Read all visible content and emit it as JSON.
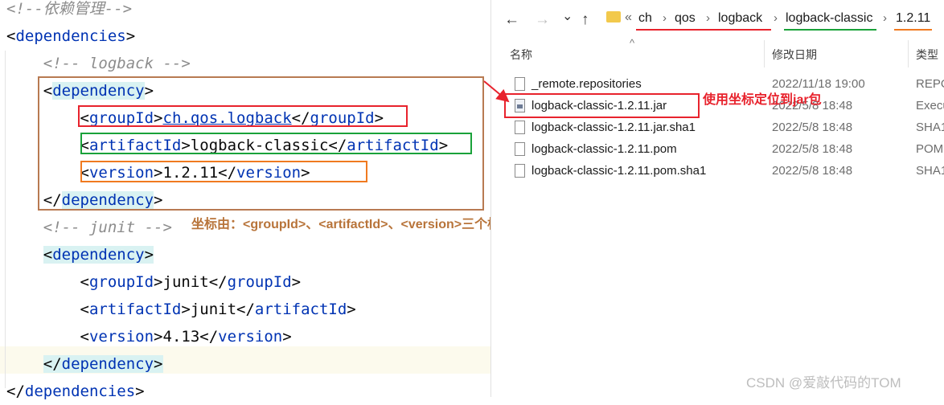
{
  "editor": {
    "lines": [
      {
        "segments": [
          {
            "text": "<!--依赖管理-->",
            "cls": "c"
          }
        ]
      },
      {
        "segments": [
          {
            "text": "<",
            "cls": "b"
          },
          {
            "text": "dependencies",
            "cls": "t"
          },
          {
            "text": ">",
            "cls": "b"
          }
        ]
      },
      {
        "segments": [
          {
            "text": "    "
          },
          {
            "text": "<!-- logback -->",
            "cls": "c"
          }
        ]
      },
      {
        "segments": [
          {
            "text": "    "
          },
          {
            "text": "<",
            "cls": "b"
          },
          {
            "text": "dependency",
            "cls": "t hl"
          },
          {
            "text": ">",
            "cls": "b"
          }
        ]
      },
      {
        "segments": [
          {
            "text": "        "
          },
          {
            "text": "<",
            "cls": "b"
          },
          {
            "text": "groupId",
            "cls": "t"
          },
          {
            "text": ">",
            "cls": "b"
          },
          {
            "text": "ch.qos.logback",
            "cls": "t u"
          },
          {
            "text": "</",
            "cls": "b"
          },
          {
            "text": "groupId",
            "cls": "t"
          },
          {
            "text": ">",
            "cls": "b"
          }
        ]
      },
      {
        "segments": [
          {
            "text": "        "
          },
          {
            "text": "<",
            "cls": "b"
          },
          {
            "text": "artifactId",
            "cls": "t"
          },
          {
            "text": ">",
            "cls": "b"
          },
          {
            "text": "logback-classic",
            "cls": "b"
          },
          {
            "text": "</",
            "cls": "b"
          },
          {
            "text": "artifactId",
            "cls": "t"
          },
          {
            "text": ">",
            "cls": "b"
          }
        ]
      },
      {
        "segments": [
          {
            "text": "        "
          },
          {
            "text": "<",
            "cls": "b"
          },
          {
            "text": "version",
            "cls": "t"
          },
          {
            "text": ">",
            "cls": "b"
          },
          {
            "text": "1.2.11",
            "cls": "b"
          },
          {
            "text": "</",
            "cls": "b"
          },
          {
            "text": "version",
            "cls": "t"
          },
          {
            "text": ">",
            "cls": "b"
          }
        ]
      },
      {
        "segments": [
          {
            "text": "    "
          },
          {
            "text": "</",
            "cls": "b"
          },
          {
            "text": "dependency",
            "cls": "t hl"
          },
          {
            "text": ">",
            "cls": "b"
          }
        ]
      },
      {
        "segments": [
          {
            "text": "    "
          },
          {
            "text": "<!-- junit -->",
            "cls": "c"
          }
        ]
      },
      {
        "segments": [
          {
            "text": "    "
          },
          {
            "text": "<",
            "cls": "b hl"
          },
          {
            "text": "dependency",
            "cls": "t hl"
          },
          {
            "text": ">",
            "cls": "b hl"
          }
        ]
      },
      {
        "segments": [
          {
            "text": "        "
          },
          {
            "text": "<",
            "cls": "b"
          },
          {
            "text": "groupId",
            "cls": "t"
          },
          {
            "text": ">",
            "cls": "b"
          },
          {
            "text": "junit",
            "cls": "b"
          },
          {
            "text": "</",
            "cls": "b"
          },
          {
            "text": "groupId",
            "cls": "t"
          },
          {
            "text": ">",
            "cls": "b"
          }
        ]
      },
      {
        "segments": [
          {
            "text": "        "
          },
          {
            "text": "<",
            "cls": "b"
          },
          {
            "text": "artifactId",
            "cls": "t"
          },
          {
            "text": ">",
            "cls": "b"
          },
          {
            "text": "junit",
            "cls": "b"
          },
          {
            "text": "</",
            "cls": "b"
          },
          {
            "text": "artifactId",
            "cls": "t"
          },
          {
            "text": ">",
            "cls": "b"
          }
        ]
      },
      {
        "segments": [
          {
            "text": "        "
          },
          {
            "text": "<",
            "cls": "b"
          },
          {
            "text": "version",
            "cls": "t"
          },
          {
            "text": ">",
            "cls": "b"
          },
          {
            "text": "4.13",
            "cls": "b"
          },
          {
            "text": "</",
            "cls": "b"
          },
          {
            "text": "version",
            "cls": "t"
          },
          {
            "text": ">",
            "cls": "b"
          }
        ]
      },
      {
        "segments": [
          {
            "text": "    "
          },
          {
            "text": "</",
            "cls": "b hl"
          },
          {
            "text": "dependency",
            "cls": "t hl"
          },
          {
            "text": ">",
            "cls": "b hl"
          }
        ]
      },
      {
        "segments": [
          {
            "text": "</",
            "cls": "b"
          },
          {
            "text": "dependencies",
            "cls": "t"
          },
          {
            "text": ">",
            "cls": "b"
          }
        ]
      }
    ]
  },
  "annotations": {
    "coordinate_note": "坐标由：<groupId>、<artifactId>、<version>三个标签组成",
    "jar_note": "使用坐标定位到jar包"
  },
  "explorer": {
    "nav": {
      "back": "←",
      "forward": "→",
      "dropdown": "⌄",
      "up": "↑",
      "overflow": "«"
    },
    "breadcrumb": [
      "ch",
      "qos",
      "logback",
      "logback-classic",
      "1.2.11"
    ],
    "columns": {
      "name": "名称",
      "modified": "修改日期",
      "type": "类型",
      "sort_arrow": "^"
    },
    "files": [
      {
        "name": "_remote.repositories",
        "modified": "2022/11/18 19:00",
        "type": "REPO",
        "icon": "file-icon"
      },
      {
        "name": "logback-classic-1.2.11.jar",
        "modified": "2022/5/8 18:48",
        "type": "Execu",
        "icon": "jar-file-icon"
      },
      {
        "name": "logback-classic-1.2.11.jar.sha1",
        "modified": "2022/5/8 18:48",
        "type": "SHA1",
        "icon": "file-icon"
      },
      {
        "name": "logback-classic-1.2.11.pom",
        "modified": "2022/5/8 18:48",
        "type": "POM",
        "icon": "file-icon"
      },
      {
        "name": "logback-classic-1.2.11.pom.sha1",
        "modified": "2022/5/8 18:48",
        "type": "SHA1",
        "icon": "file-icon"
      }
    ]
  },
  "watermark": "CSDN @爱敲代码的TOM",
  "colors": {
    "red": "#e8232d",
    "green": "#1aa23a",
    "orange": "#f07a20",
    "brown": "#b87a52",
    "annotation_text": "#b8743a",
    "tag": "#0033b3",
    "tag_highlight": "#d9f2f2"
  }
}
